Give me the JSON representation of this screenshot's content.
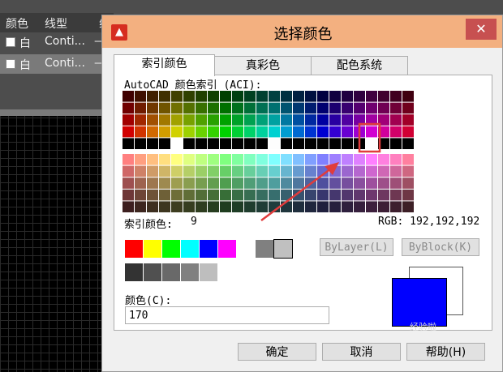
{
  "layer_manager": {
    "col_color": "颜色",
    "col_linetype": "线型",
    "col_partial": "线",
    "rows": [
      {
        "color": "白",
        "linetype": "Conti...",
        "lineweight": "—"
      },
      {
        "color": "白",
        "linetype": "Conti...",
        "lineweight": "—"
      }
    ]
  },
  "dialog": {
    "title": "选择颜色",
    "close_label": "✕",
    "tabs": [
      "索引颜色",
      "真彩色",
      "配色系统"
    ],
    "aci_heading": "AutoCAD 颜色索引 (ACI):",
    "index_color_label": "索引颜色:",
    "index_color_value": "9",
    "rgb_text": "RGB: 192,192,192",
    "bylayer_label": "ByLayer(L)",
    "byblock_label": "ByBlock(K)",
    "color_field_label": "颜色(C):",
    "color_field_value": "170",
    "ok_label": "确定",
    "cancel_label": "取消",
    "help_label": "帮助(H)",
    "selected_color": "#0000ff",
    "basic_colors": [
      "#ff0000",
      "#ffff00",
      "#00ff00",
      "#00ffff",
      "#0000ff",
      "#ff00ff",
      "#ffffff",
      "#808080",
      "#c0c0c0"
    ],
    "gray_colors": [
      "#333333",
      "#505050",
      "#696969",
      "#808080",
      "#bebebe",
      "#ffffff"
    ],
    "annotation_color": "#e03c3c"
  },
  "watermark": "经验啦"
}
